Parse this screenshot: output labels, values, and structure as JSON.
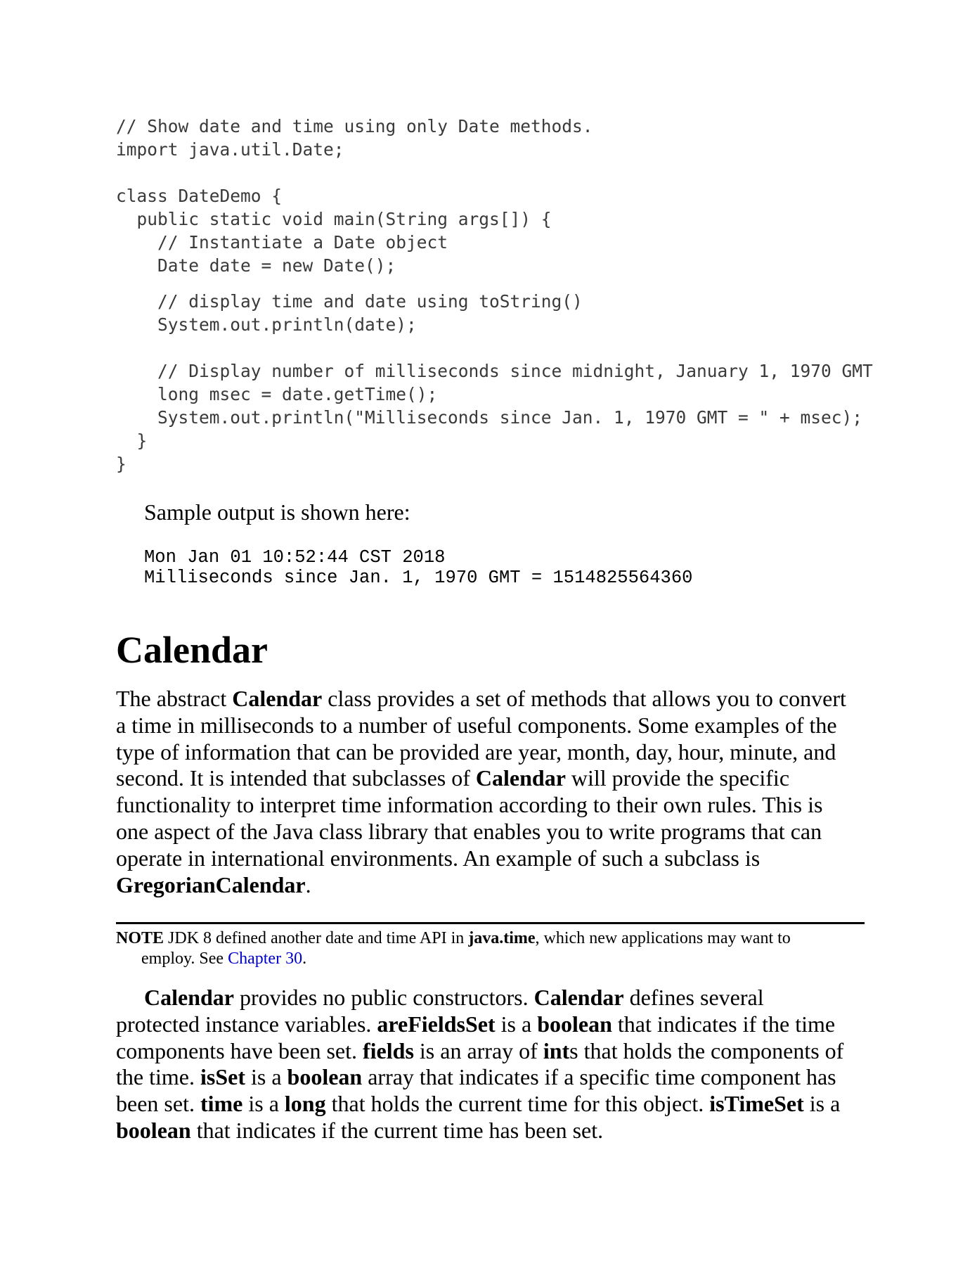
{
  "code_listing": {
    "lines": [
      "// Show date and time using only Date methods.",
      "import java.util.Date;",
      "",
      "class DateDemo {",
      "  public static void main(String args[]) {",
      "    // Instantiate a Date object",
      "    Date date = new Date();",
      "    // display time and date using toString()",
      "    System.out.println(date);",
      "",
      "    // Display number of milliseconds since midnight, January 1, 1970 GMT",
      "    long msec = date.getTime();",
      "    System.out.println(\"Milliseconds since Jan. 1, 1970 GMT = \" + msec);",
      "  }",
      "}"
    ]
  },
  "sample": {
    "intro": "Sample output is shown here:",
    "output_lines": [
      "Mon Jan 01 10:52:44 CST 2018",
      "Milliseconds since Jan. 1, 1970 GMT = 1514825564360"
    ]
  },
  "section": {
    "heading": "Calendar"
  },
  "paragraph1": {
    "l1_a": "The abstract ",
    "l1_b": "Calendar",
    "l1_c": " class provides a set of methods that allows you to convert",
    "l2": "a time in milliseconds to a number of useful components. Some examples of the",
    "l3": "type of information that can be provided are year, month, day, hour, minute, and",
    "l4_a": "second. It is intended that subclasses of ",
    "l4_b": "Calendar",
    "l4_c": " will provide the specific",
    "l5": "functionality to interpret time information according to their own rules. This is",
    "l6": "one aspect of the Java class library that enables you to write programs that can",
    "l7": "operate in international environments. An example of such a subclass is",
    "l8_a": "GregorianCalendar",
    "l8_b": "."
  },
  "note": {
    "label": "NOTE",
    "text_a": " JDK 8 defined another date and time API in ",
    "text_b": "java.time",
    "text_c": ", which new applications may want to",
    "text_d": "employ. See ",
    "link": "Chapter 30",
    "text_e": "."
  },
  "paragraph2": {
    "l1_a": "Calendar",
    "l1_b": " provides no public constructors. ",
    "l1_c": "Calendar",
    "l1_d": " defines several",
    "l2_a": "protected instance variables. ",
    "l2_b": "areFieldsSet",
    "l2_c": " is a ",
    "l2_d": "boolean",
    "l2_e": " that indicates if the time",
    "l3_a": "components have been set. ",
    "l3_b": "fields",
    "l3_c": " is an array of ",
    "l3_d": "int",
    "l3_e": "s that holds the components of",
    "l4_a": "the time. ",
    "l4_b": "isSet",
    "l4_c": " is a ",
    "l4_d": "boolean",
    "l4_e": " array that indicates if a specific time component has",
    "l5_a": "been set. ",
    "l5_b": "time",
    "l5_c": " is a ",
    "l5_d": "long",
    "l5_e": " that holds the current time for this object. ",
    "l5_f": "isTimeSet",
    "l5_g": " is a",
    "l6_a": "boolean",
    "l6_b": " that indicates if the current time has been set."
  }
}
